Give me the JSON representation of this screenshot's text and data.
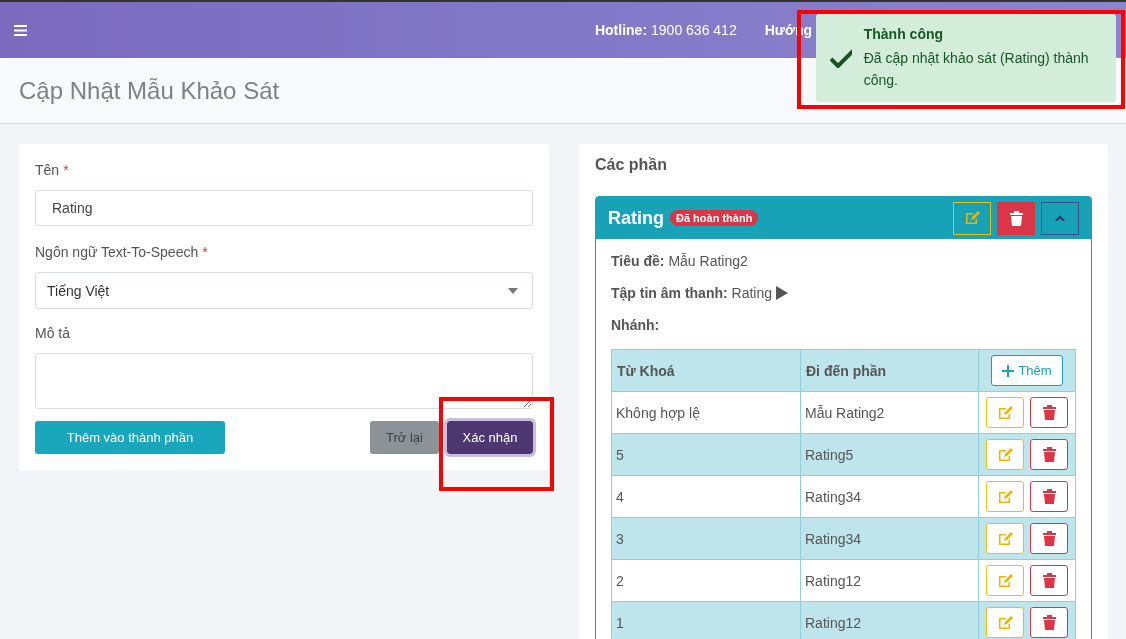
{
  "header": {
    "hotline_label": "Hotline:",
    "hotline_number": "1900 636 412",
    "link": "Hướng"
  },
  "page_title": "Cập Nhật Mẫu Khảo Sát",
  "toast": {
    "title": "Thành công",
    "message": "Đã cập nhật khảo sát (Rating) thành công.",
    "highlighted": true
  },
  "form": {
    "fields": [
      {
        "kind": "input",
        "label": "Tên",
        "required_mark": "*",
        "value": "Rating"
      },
      {
        "kind": "select",
        "label": "Ngôn ngữ Text-To-Speech",
        "required_mark": "*",
        "value": "Tiếng Việt"
      },
      {
        "kind": "textarea",
        "label": "Mô tả"
      }
    ],
    "add_button": "Thêm vào thành phần",
    "back_button": "Trở lại",
    "confirm_button": "Xác nhận",
    "confirm_highlighted": true
  },
  "sections": {
    "title": "Các phần",
    "panel": {
      "name": "Rating",
      "badge": "Đã hoàn thành",
      "expanded": true,
      "title_label": "Tiêu đề:",
      "title_value": "Mẫu Rating2",
      "audio_label": "Tập tin âm thanh:",
      "audio_value": "Rating",
      "branch_label": "Nhánh:",
      "columns": [
        "Từ Khoá",
        "Đi đến phần"
      ],
      "add_label": "Thêm",
      "rows": [
        {
          "keyword": "Không hợp lệ",
          "target": "Mẫu Rating2"
        },
        {
          "keyword": "5",
          "target": "Rating5"
        },
        {
          "keyword": "4",
          "target": "Rating34"
        },
        {
          "keyword": "3",
          "target": "Rating34"
        },
        {
          "keyword": "2",
          "target": "Rating12"
        },
        {
          "keyword": "1",
          "target": "Rating12"
        }
      ]
    }
  }
}
